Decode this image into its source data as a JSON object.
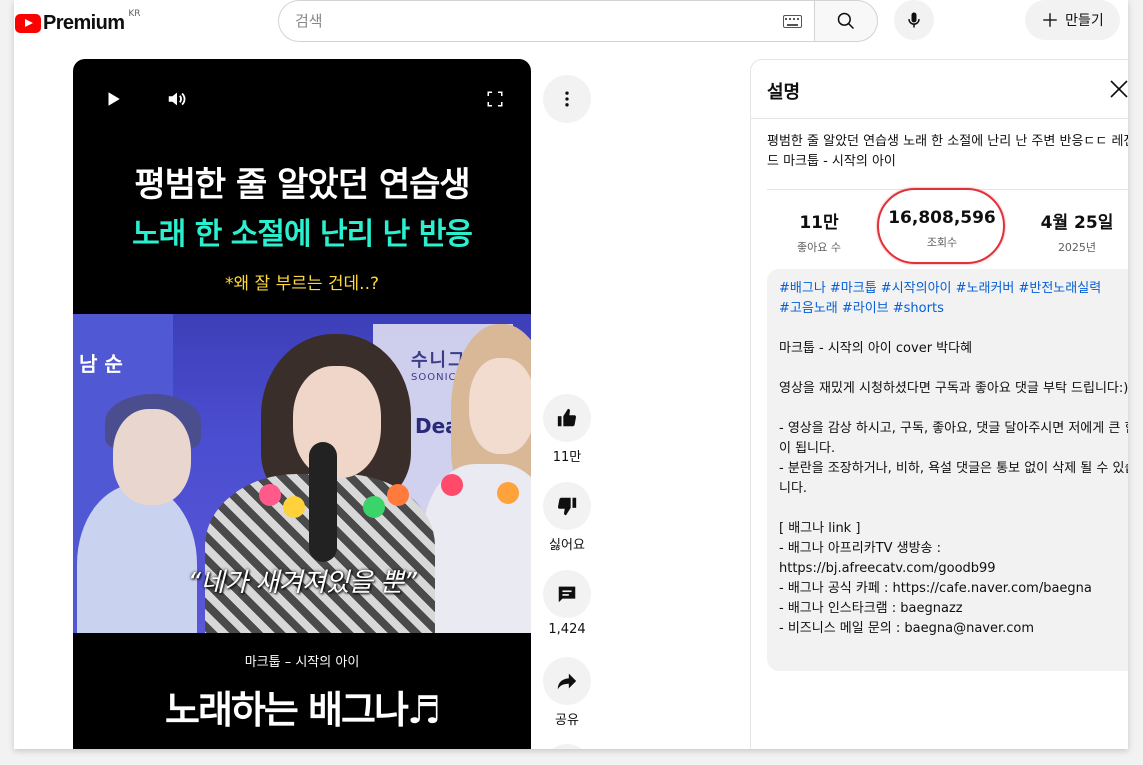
{
  "header": {
    "logo_text": "Premium",
    "logo_sup": "KR",
    "search_placeholder": "검색",
    "create_label": "만들기"
  },
  "video": {
    "overlay_title_line1": "평범한 줄 알았던 연습생",
    "overlay_title_line2": "노래 한 소절에 난리 난 반응",
    "overlay_caption": "*왜 잘 부르는 건데..?",
    "scene_sign_left": "남 순",
    "scene_sign_right": "수니그",
    "scene_sign_right_sub": "SOONICO",
    "scene_sign_banner": "Dea MAT",
    "subtitle": "“네가 새겨져있을 뿐”",
    "song_credit": "마크툽 – 시작의 아이",
    "channel_title": "노래하는 배그나♬"
  },
  "actions": {
    "like_count": "11만",
    "dislike_label": "싫어요",
    "comment_count": "1,424",
    "share_label": "공유"
  },
  "description": {
    "panel_title": "설명",
    "video_title": "평범한 줄 알았던 연습생 노래 한 소절에 난리 난 주변 반응ㄷㄷ 레전드 마크툽 - 시작의 아이",
    "stats": {
      "likes_value": "11만",
      "likes_label": "좋아요 수",
      "views_value": "16,808,596",
      "views_label": "조회수",
      "date_value": "4월 25일",
      "date_year": "2025년"
    },
    "hashtags_line1": "#배그나 #마크툽 #시작의아이 #노래커버 #반전노래실력",
    "hashtags_line2": "#고음노래 #라이브 #shorts",
    "credit": "마크툽 - 시작의 아이 cover 박다혜",
    "request": "영상을 재밌게 시청하셨다면 구독과 좋아요 댓글 부탁 드립니다:)",
    "rule1": "- 영상을 감상 하시고, 구독, 좋아요, 댓글 달아주시면 저에게 큰 힘이 됩니다.",
    "rule2": "- 분란을 조장하거나, 비하, 욕설 댓글은 통보 없이 삭제 될 수 있습니다.",
    "links_header": "[ 배그나 link ]",
    "link_afreeca_label": "- 배그나 아프리카TV 생방송 :",
    "link_afreeca_url": "https://bj.afreecatv.com/goodb99",
    "link_cafe": "- 배그나 공식 카페 : https://cafe.naver.com/baegna",
    "link_instagram": "- 배그나 인스타크램 : baegnazz",
    "link_business": "- 비즈니스 메일 문의 : baegna@naver.com"
  }
}
